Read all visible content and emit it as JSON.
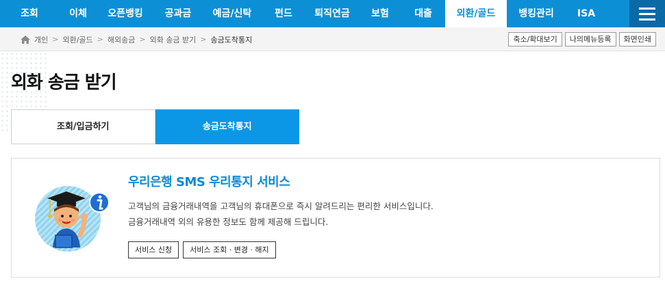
{
  "gnb": {
    "items": [
      {
        "label": "조회"
      },
      {
        "label": "이체"
      },
      {
        "label": "오픈뱅킹"
      },
      {
        "label": "공과금"
      },
      {
        "label": "예금/신탁"
      },
      {
        "label": "펀드"
      },
      {
        "label": "퇴직연금"
      },
      {
        "label": "보험"
      },
      {
        "label": "대출"
      },
      {
        "label": "외환/골드"
      },
      {
        "label": "뱅킹관리"
      },
      {
        "label": "ISA"
      }
    ],
    "active_index": 9,
    "menu_icon": "hamburger-icon"
  },
  "breadcrumb": {
    "home_icon": "home-icon",
    "items": [
      "개인",
      "외환/골드",
      "해외송금",
      "외화 송금 받기",
      "송금도착통지"
    ],
    "separator": ">"
  },
  "util": {
    "zoom_label": "축소/확대보기",
    "mymenu_label": "나의메뉴등록",
    "print_label": "화면인쇄"
  },
  "page": {
    "title": "외화 송금 받기"
  },
  "tabs": [
    {
      "label": "조회/입금하기",
      "active": false
    },
    {
      "label": "송금도착통지",
      "active": true
    }
  ],
  "service": {
    "title": "우리은행 SMS 우리통지 서비스",
    "desc_line1": "고객님의 금융거래내역을 고객님의 휴대폰으로 즉시 알려드리는 편리한 서비스입니다.",
    "desc_line2": "금융거래내역 외의 유용한 정보도 함께 제공해 드립니다.",
    "apply_label": "서비스 신청",
    "manage_label": "서비스 조회 · 변경 · 해지",
    "illustration": "graduate-student-info-icon"
  },
  "colors": {
    "brand": "#0d8fd6",
    "tab_active": "#0b97e6",
    "title_blue": "#0b8ad9"
  }
}
